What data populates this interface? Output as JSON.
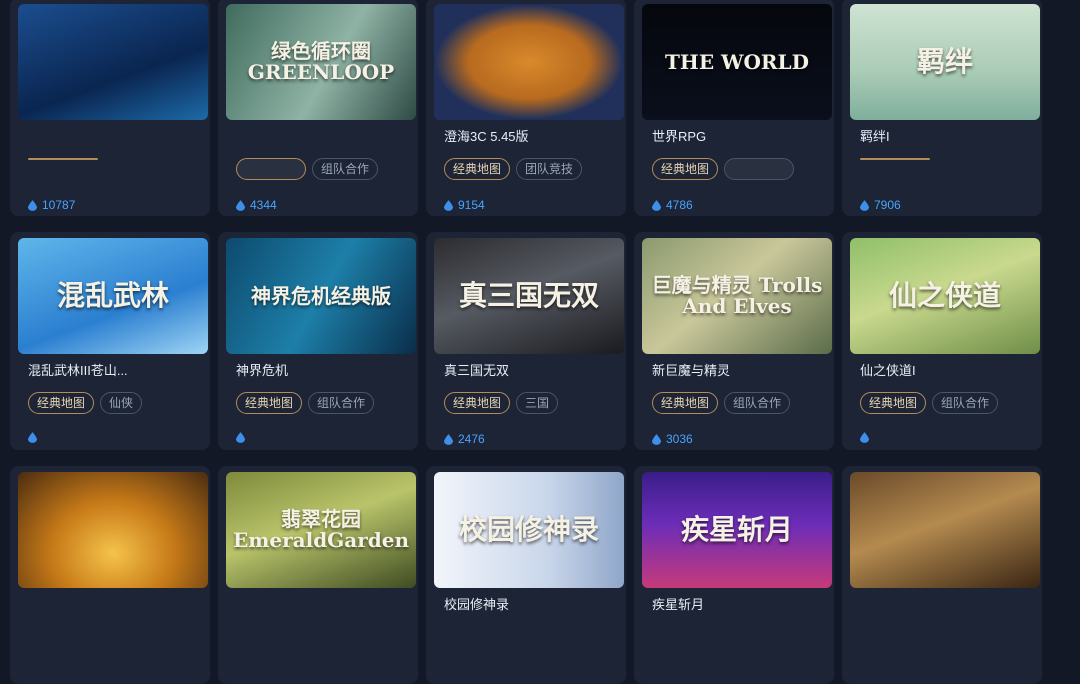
{
  "rows": [
    [
      {
        "title": "",
        "thumb_text": "",
        "thumb_bg": "linear-gradient(160deg,#1b4e8f,#0a2550 60%,#1d6aa8)",
        "tags": [
          {
            "label": "",
            "primary": true,
            "blur": true
          }
        ],
        "heat": "10787",
        "heat_blur": false
      },
      {
        "title": "",
        "thumb_text": "绿色循环圈 GREENLOOP",
        "thumb_bg": "linear-gradient(120deg,#3f6b5d,#8fb3a5 55%,#2e4a44)",
        "tags": [
          {
            "label": "",
            "primary": true,
            "blur": true
          },
          {
            "label": "组队合作",
            "primary": false,
            "blur": false
          }
        ],
        "heat": "4344",
        "heat_blur": false
      },
      {
        "title": "澄海3C 5.45版",
        "thumb_text": "",
        "thumb_bg": "radial-gradient(ellipse at center,#d98a2b 0%,#b86a1f 45%,#20305a 70%)",
        "tags": [
          {
            "label": "经典地图",
            "primary": true,
            "blur": false
          },
          {
            "label": "团队竞技",
            "primary": false,
            "blur": false
          }
        ],
        "heat": "9154",
        "heat_blur": false
      },
      {
        "title": "世界RPG",
        "thumb_text": "THE WORLD",
        "thumb_bg": "linear-gradient(180deg,#05070d,#0a0f1c)",
        "tags": [
          {
            "label": "经典地图",
            "primary": true,
            "blur": false
          },
          {
            "label": "",
            "primary": false,
            "blur": true
          }
        ],
        "heat": "4786",
        "heat_blur": false
      },
      {
        "title": "羁绊I",
        "thumb_text": "羁绊",
        "thumb_bg": "linear-gradient(180deg,#cfe3d2,#a9cbb6 60%,#7fae9c)",
        "tags": [
          {
            "label": "",
            "primary": true,
            "blur": true
          }
        ],
        "heat": "7906",
        "heat_blur": false
      }
    ],
    [
      {
        "title": "混乱武林III苍山...",
        "thumb_text": "混乱武林",
        "thumb_bg": "linear-gradient(160deg,#5fb6ea,#2b7fd0 60%,#9ed4f5)",
        "tags": [
          {
            "label": "经典地图",
            "primary": true,
            "blur": false
          },
          {
            "label": "仙侠",
            "primary": false,
            "blur": false
          }
        ],
        "heat": "",
        "heat_blur": true
      },
      {
        "title": "神界危机",
        "thumb_text": "神界危机经典版",
        "thumb_bg": "linear-gradient(120deg,#0d4a6e,#1d7fa8 50%,#0a2d4a)",
        "tags": [
          {
            "label": "经典地图",
            "primary": true,
            "blur": false
          },
          {
            "label": "组队合作",
            "primary": false,
            "blur": false
          }
        ],
        "heat": "",
        "heat_blur": true
      },
      {
        "title": "真三国无双",
        "thumb_text": "真三国无双",
        "thumb_bg": "linear-gradient(160deg,#2c2c30,#565a62 45%,#1a1b1f)",
        "tags": [
          {
            "label": "经典地图",
            "primary": true,
            "blur": false
          },
          {
            "label": "三国",
            "primary": false,
            "blur": false
          }
        ],
        "heat": "2476",
        "heat_blur": false
      },
      {
        "title": "新巨魔与精灵",
        "thumb_text": "巨魔与精灵 Trolls And Elves",
        "thumb_bg": "linear-gradient(140deg,#8a9a6e,#c9c79a 45%,#5b6c4a)",
        "tags": [
          {
            "label": "经典地图",
            "primary": true,
            "blur": false
          },
          {
            "label": "组队合作",
            "primary": false,
            "blur": false
          }
        ],
        "heat": "3036",
        "heat_blur": false
      },
      {
        "title": "仙之侠道I",
        "thumb_text": "仙之侠道",
        "thumb_bg": "linear-gradient(160deg,#8fbf6a,#c9d98e 45%,#6f8e48)",
        "tags": [
          {
            "label": "经典地图",
            "primary": true,
            "blur": false
          },
          {
            "label": "组队合作",
            "primary": false,
            "blur": false
          }
        ],
        "heat": "",
        "heat_blur": true
      }
    ],
    [
      {
        "title": "",
        "thumb_text": "",
        "thumb_bg": "radial-gradient(ellipse at 50% 70%,#f5c34a,#c77a18 45%,#4a2c10)",
        "tags": [],
        "heat": "",
        "heat_blur": true
      },
      {
        "title": "",
        "thumb_text": "翡翠花园 EmeraldGarden",
        "thumb_bg": "linear-gradient(160deg,#7f8a3c,#b9c46a 45%,#3f4c22)",
        "tags": [],
        "heat": "",
        "heat_blur": true
      },
      {
        "title": "校园修神录",
        "thumb_text": "校园修神录",
        "thumb_bg": "linear-gradient(90deg,#f2f5fb,#c9d6ea 60%,#8fa6c9)",
        "tags": [],
        "heat": "",
        "heat_blur": false
      },
      {
        "title": "疾星斩月",
        "thumb_text": "疾星斩月",
        "thumb_bg": "linear-gradient(180deg,#3a1d8a,#6c2db8 45%,#c63a7a)",
        "tags": [],
        "heat": "",
        "heat_blur": false
      },
      {
        "title": "",
        "thumb_text": "",
        "thumb_bg": "linear-gradient(160deg,#6b4a2a,#b48a4f 45%,#3a2614)",
        "tags": [],
        "heat": "",
        "heat_blur": false
      }
    ]
  ],
  "colors": {
    "background": "#121826",
    "card": "#1c2435",
    "accent": "#4aa3ff",
    "tag_primary_border": "#b48c5a"
  }
}
